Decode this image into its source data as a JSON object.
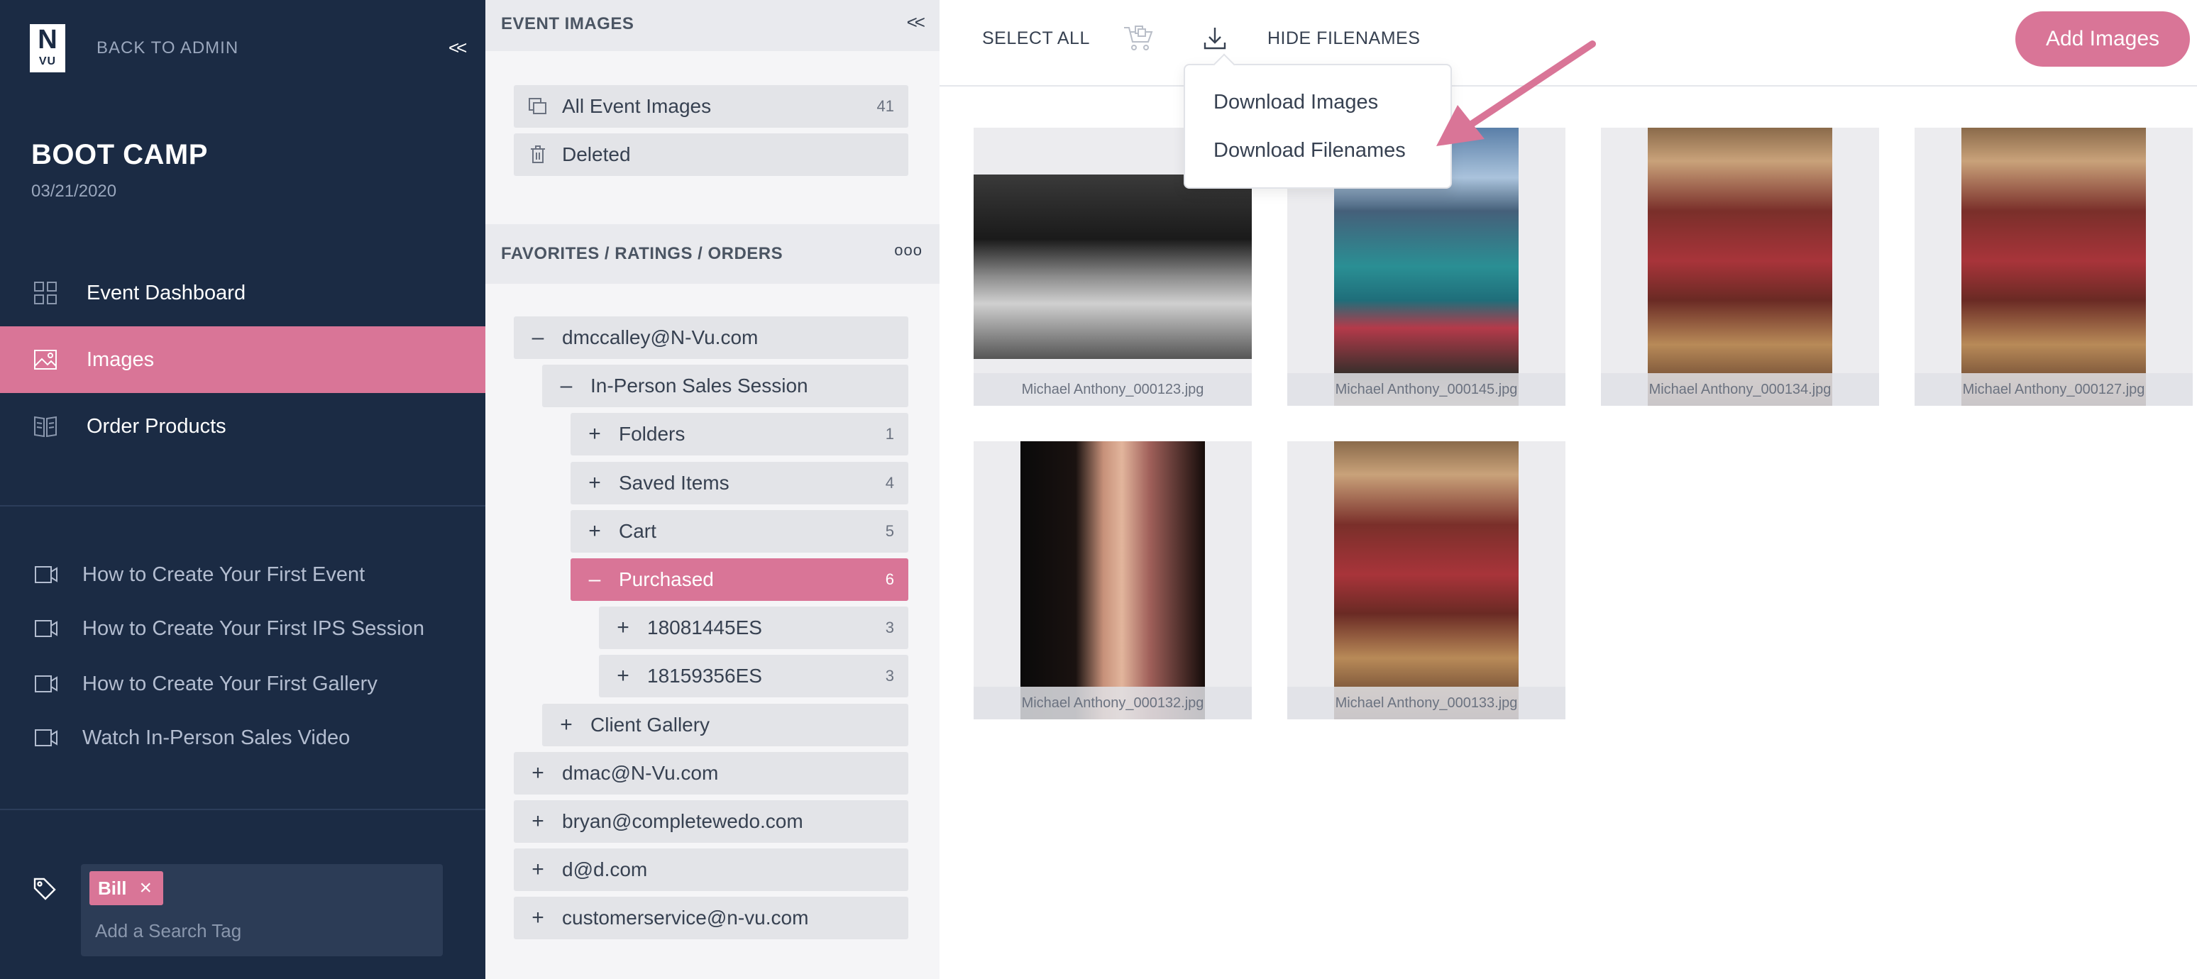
{
  "sidebar": {
    "logo": {
      "top": "N",
      "bottom": "VU"
    },
    "back_label": "BACK TO ADMIN",
    "collapse_label": "<<",
    "event_title": "BOOT CAMP",
    "event_date": "03/21/2020",
    "nav": [
      {
        "label": "Event Dashboard",
        "icon": "grid-icon",
        "active": false
      },
      {
        "label": "Images",
        "icon": "image-icon",
        "active": true
      },
      {
        "label": "Order Products",
        "icon": "book-icon",
        "active": false
      }
    ],
    "help": [
      {
        "label": "How to Create Your First Event",
        "icon": "video-icon"
      },
      {
        "label": "How to Create Your First IPS Session",
        "icon": "video-icon"
      },
      {
        "label": "How to Create Your First Gallery",
        "icon": "video-icon"
      },
      {
        "label": "Watch In-Person Sales Video",
        "icon": "video-icon"
      }
    ],
    "tags": {
      "chips": [
        "Bill"
      ],
      "placeholder": "Add a Search Tag"
    }
  },
  "middle": {
    "header": "EVENT IMAGES",
    "collapse_label": "<<",
    "items": [
      {
        "label": "All Event Images",
        "count": "41",
        "icon": "images-icon"
      },
      {
        "label": "Deleted",
        "count": "",
        "icon": "trash-icon"
      }
    ],
    "fav_header": "FAVORITES / RATINGS / ORDERS",
    "fav_more": "ooo",
    "tree": [
      {
        "label": "dmccalley@N-Vu.com",
        "symbol": "–",
        "count": "",
        "level": 0,
        "active": false
      },
      {
        "label": "In-Person Sales Session",
        "symbol": "–",
        "count": "",
        "level": 1,
        "active": false
      },
      {
        "label": "Folders",
        "symbol": "+",
        "count": "1",
        "level": 2,
        "active": false
      },
      {
        "label": "Saved Items",
        "symbol": "+",
        "count": "4",
        "level": 2,
        "active": false
      },
      {
        "label": "Cart",
        "symbol": "+",
        "count": "5",
        "level": 2,
        "active": false
      },
      {
        "label": "Purchased",
        "symbol": "–",
        "count": "6",
        "level": 2,
        "active": true
      },
      {
        "label": "18081445ES",
        "symbol": "+",
        "count": "3",
        "level": 3,
        "active": false
      },
      {
        "label": "18159356ES",
        "symbol": "+",
        "count": "3",
        "level": 3,
        "active": false
      },
      {
        "label": "Client Gallery",
        "symbol": "+",
        "count": "",
        "level": 1,
        "active": false
      },
      {
        "label": "dmac@N-Vu.com",
        "symbol": "+",
        "count": "",
        "level": 0,
        "active": false
      },
      {
        "label": "bryan@completewedo.com",
        "symbol": "+",
        "count": "",
        "level": 0,
        "active": false
      },
      {
        "label": "d@d.com",
        "symbol": "+",
        "count": "",
        "level": 0,
        "active": false
      },
      {
        "label": "customerservice@n-vu.com",
        "symbol": "+",
        "count": "",
        "level": 0,
        "active": false
      }
    ]
  },
  "toolbar": {
    "select_all": "SELECT ALL",
    "hide_filenames": "HIDE FILENAMES",
    "add_images": "Add Images",
    "icons": [
      "shopping-cart-icon",
      "download-icon"
    ]
  },
  "download_menu": {
    "items": [
      "Download Images",
      "Download Filenames"
    ]
  },
  "images": [
    {
      "filename": "Michael Anthony_000123.jpg",
      "orientation": "landscape",
      "palette": "bw"
    },
    {
      "filename": "Michael Anthony_000145.jpg",
      "orientation": "portrait",
      "palette": "lake"
    },
    {
      "filename": "Michael Anthony_000134.jpg",
      "orientation": "portrait",
      "palette": "bride"
    },
    {
      "filename": "Michael Anthony_000127.jpg",
      "orientation": "portrait",
      "palette": "bride"
    },
    {
      "filename": "Michael Anthony_000132.jpg",
      "orientation": "portrait",
      "palette": "lipstick"
    },
    {
      "filename": "Michael Anthony_000133.jpg",
      "orientation": "portrait",
      "palette": "bride"
    }
  ],
  "colors": {
    "sidebar_bg": "#1b2b44",
    "accent": "#d97597",
    "panel_bg": "#f5f5f7"
  }
}
